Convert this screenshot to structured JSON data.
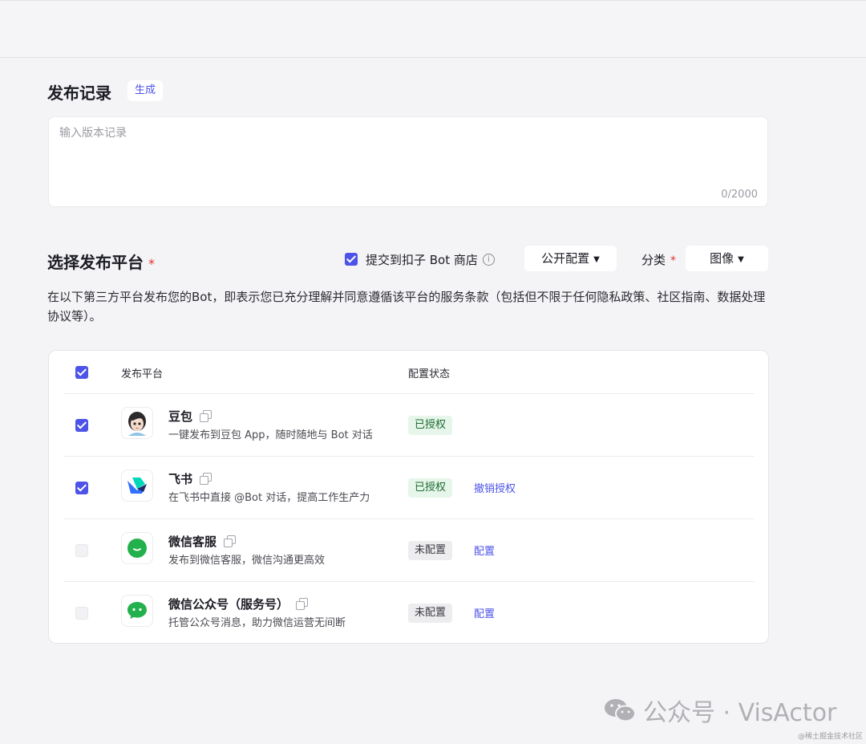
{
  "release_notes": {
    "title": "发布记录",
    "generate_label": "生成",
    "placeholder": "输入版本记录",
    "char_count": "0/2000"
  },
  "platform_select": {
    "title": "选择发布平台",
    "required_mark": "*",
    "store_option": {
      "label": "提交到扣子 Bot 商店",
      "checked": true
    },
    "visibility_dropdown": "公开配置",
    "category_label": "分类",
    "category_dropdown": "图像",
    "terms_text": "在以下第三方平台发布您的Bot，即表示您已充分理解并同意遵循该平台的服务条款（包括但不限于任何隐私政策、社区指南、数据处理协议等）。"
  },
  "table": {
    "columns": [
      "发布平台",
      "配置状态"
    ],
    "all_checked": true,
    "rows": [
      {
        "name": "豆包",
        "desc": "一键发布到豆包 App，随时随地与 Bot 对话",
        "status": "已授权",
        "status_type": "ok",
        "action": "",
        "checked": true,
        "icon": "doubao-avatar-icon"
      },
      {
        "name": "飞书",
        "desc": "在飞书中直接 @Bot 对话，提高工作生产力",
        "status": "已授权",
        "status_type": "ok",
        "action": "撤销授权",
        "checked": true,
        "icon": "feishu-logo-icon"
      },
      {
        "name": "微信客服",
        "desc": "发布到微信客服，微信沟通更高效",
        "status": "未配置",
        "status_type": "no",
        "action": "配置",
        "checked": false,
        "icon": "wechat-service-icon"
      },
      {
        "name": "微信公众号（服务号）",
        "desc": "托管公众号消息，助力微信运营无间断",
        "status": "未配置",
        "status_type": "no",
        "action": "配置",
        "checked": false,
        "icon": "wechat-official-icon"
      }
    ]
  },
  "watermark": {
    "main": "公众号 · VisActor",
    "small": "@稀土掘金技术社区"
  },
  "colors": {
    "accent": "#4d53e8",
    "authorized_bg": "#e6f6ea",
    "authorized_text": "#1d6b32",
    "required": "#e1352f"
  }
}
